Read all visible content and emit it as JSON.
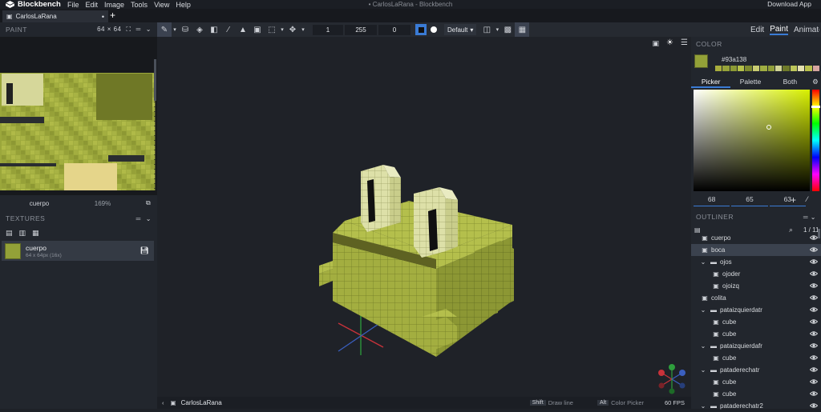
{
  "app": {
    "name": "Blockbench",
    "window_title": "CarlosLaRana - Blockbench",
    "download_label": "Download App",
    "menu": [
      "File",
      "Edit",
      "Image",
      "Tools",
      "View",
      "Help"
    ]
  },
  "tabs": [
    {
      "label": "CarlosLaRana",
      "modified_marker": "•"
    }
  ],
  "new_tab_label": "+",
  "toolbar": {
    "size_value": "1",
    "opacity_value": "255",
    "softness_value": "0",
    "blend_mode": "Default"
  },
  "modes": {
    "edit": "Edit",
    "paint": "Paint",
    "animate": "Animate"
  },
  "paint_panel": {
    "title": "PAINT",
    "resolution": "64 × 64",
    "texture_name": "cuerpo",
    "zoom": "169%"
  },
  "textures_panel": {
    "title": "TEXTURES",
    "items": [
      {
        "name": "cuerpo",
        "meta": "64 x 64px (16x)"
      }
    ]
  },
  "color_panel": {
    "title": "COLOR",
    "hex": "#93a138",
    "tabs": [
      "Picker",
      "Palette",
      "Both"
    ],
    "active_tab": "Picker",
    "h": "68",
    "s": "65",
    "v": "63",
    "colors": {
      "main": "#93a138",
      "accent": "#3a7bd5"
    },
    "recent": [
      "#a8ad3d",
      "#96a33a",
      "#8c9a35",
      "#b4c04a",
      "#7e8a2f",
      "#c9cc72",
      "#a0ae42",
      "#909e3a",
      "#d3d597",
      "#6f7a2a",
      "#bcc55a",
      "#e4e0b0",
      "#b9c04c",
      "#d7a5a0"
    ]
  },
  "outliner": {
    "title": "OUTLINER",
    "counter": "1 / 11",
    "items": [
      {
        "label": "cuerpo",
        "depth": 1,
        "icon": "cube",
        "selected": false
      },
      {
        "label": "boca",
        "depth": 1,
        "icon": "cube",
        "selected": true
      },
      {
        "label": "ojos",
        "depth": 1,
        "icon": "folder",
        "selected": false
      },
      {
        "label": "ojoder",
        "depth": 2,
        "icon": "cube",
        "selected": false
      },
      {
        "label": "ojoizq",
        "depth": 2,
        "icon": "cube",
        "selected": false
      },
      {
        "label": "colita",
        "depth": 1,
        "icon": "cube",
        "selected": false
      },
      {
        "label": "pataizquierdatr",
        "depth": 1,
        "icon": "folder",
        "selected": false
      },
      {
        "label": "cube",
        "depth": 2,
        "icon": "cube",
        "selected": false
      },
      {
        "label": "cube",
        "depth": 2,
        "icon": "cube",
        "selected": false
      },
      {
        "label": "pataizquierdafr",
        "depth": 1,
        "icon": "folder",
        "selected": false
      },
      {
        "label": "cube",
        "depth": 2,
        "icon": "cube",
        "selected": false
      },
      {
        "label": "patаderechatr",
        "depth": 1,
        "icon": "folder",
        "selected": false
      },
      {
        "label": "cube",
        "depth": 2,
        "icon": "cube",
        "selected": false
      },
      {
        "label": "cube",
        "depth": 2,
        "icon": "cube",
        "selected": false
      },
      {
        "label": "patаderechatr2",
        "depth": 1,
        "icon": "folder",
        "selected": false
      }
    ]
  },
  "status": {
    "project": "CarlosLaRana",
    "hint1_key": "Shift",
    "hint1": "Draw line",
    "hint2_key": "Alt",
    "hint2": "Color Picker",
    "fps": "60 FPS"
  }
}
